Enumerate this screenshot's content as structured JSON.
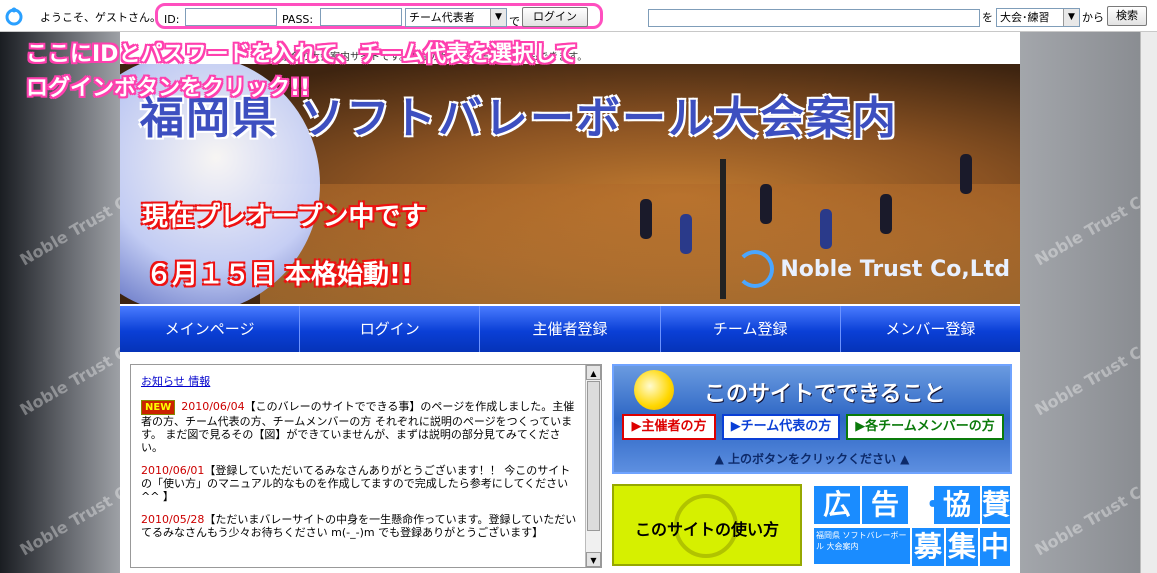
{
  "topbar": {
    "welcome": "ようこそ、ゲストさん。",
    "id_label": "ID:",
    "pass_label": "PASS:",
    "role_select": "チーム代表者",
    "de": "で",
    "login_button": "ログイン",
    "search_placeholder": "",
    "wo": "を",
    "search_scope": "大会･練習",
    "kara": "から",
    "search_button": "検索"
  },
  "annotation": {
    "line1": "ここにIDとパスワードを入れて、チーム代表を選択して",
    "line2": "ログインボタンをクリック!!"
  },
  "subline": "議会の大会案内サイトです。大会の登録やチームの管理もできます。",
  "banner": {
    "title1": "福岡県",
    "title2": "ソフトバレーボール大会案内",
    "sub1": "現在プレオープン中です",
    "sub2": "６月１５日 本格始動!!",
    "brand": "Noble Trust Co,Ltd"
  },
  "nav": [
    "メインページ",
    "ログイン",
    "主催者登録",
    "チーム登録",
    "メンバー登録"
  ],
  "news": {
    "heading": "お知らせ 情報",
    "badge": "NEW",
    "entries": [
      {
        "date": "2010/06/04",
        "text": "【このバレーのサイトでできる事】のページを作成しました。主催者の方、チーム代表の方、チームメンバーの方 それぞれに説明のページをつくっています。 まだ図で見るその【図】ができていませんが、まずは説明の部分見てみてください。"
      },
      {
        "date": "2010/06/01",
        "text": "【登録していただいてるみなさんありがとうございます！！ 今このサイトの「使い方」のマニュアル的なものを作成してますので完成したら参考にしてください^^ 】"
      },
      {
        "date": "2010/05/28",
        "text": "【ただいまバレーサイトの中身を一生懸命作っています。登録していただいてるみなさんもう少々お待ちください m(-_-)m でも登録ありがとうございます】"
      }
    ]
  },
  "can_panel": {
    "title": "このサイトでできること",
    "btn_organizer": "▶主催者の方",
    "btn_team_rep": "▶チーム代表の方",
    "btn_member": "▶各チームメンバーの方",
    "footer": "▲ 上のボタンをクリックください ▲"
  },
  "howto": "このサイトの使い方",
  "ad": {
    "cells": [
      "広",
      "告",
      "・",
      "協",
      "賛",
      "募",
      "集",
      "中"
    ],
    "small": "福岡県\nソフトバレーボール\n大会案内"
  },
  "watermark": "Noble Trust Co,Ltd"
}
